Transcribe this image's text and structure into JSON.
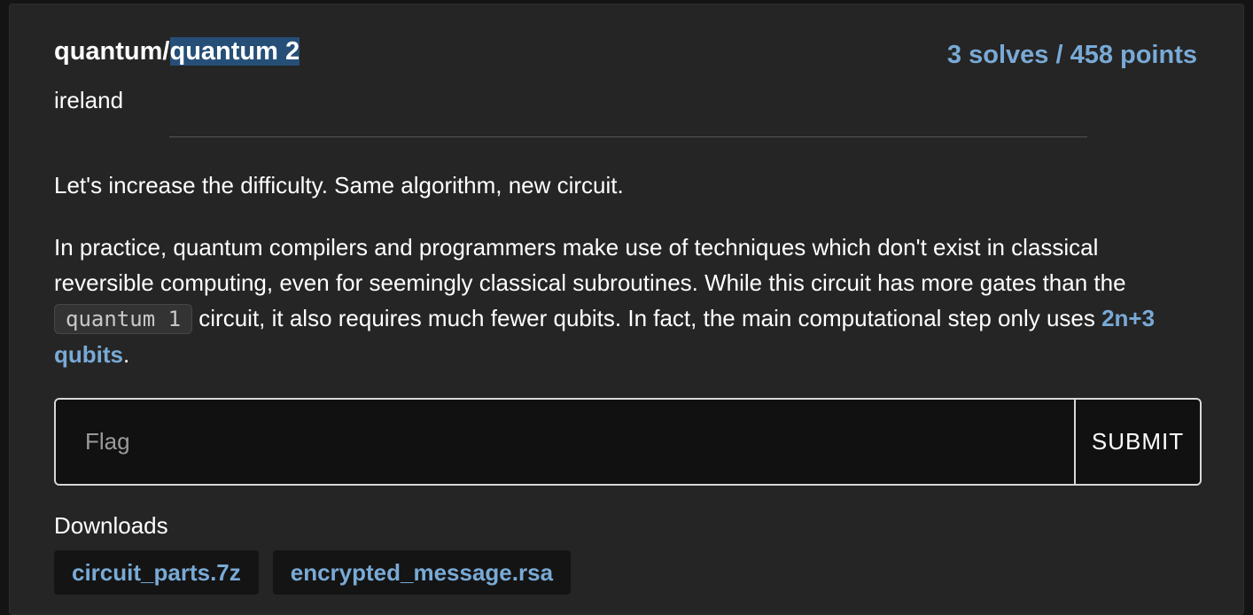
{
  "challenge": {
    "title_prefix": "quantum/",
    "title_selected": "quantum 2",
    "score": "3 solves / 458 points",
    "author": "ireland"
  },
  "description": {
    "p1": "Let's increase the difficulty. Same algorithm, new circuit.",
    "p2_part1": "In practice, quantum compilers and programmers make use of techniques which don't exist in classical reversible computing, even for seemingly classical subroutines. While this circuit has more gates than the ",
    "p2_code": "quantum 1",
    "p2_part2": " circuit, it also requires much fewer qubits. In fact, the main computational step only uses ",
    "p2_link": "2n+3 qubits",
    "p2_end": "."
  },
  "flag_form": {
    "placeholder": "Flag",
    "value": "",
    "submit_label": "SUBMIT"
  },
  "downloads": {
    "label": "Downloads",
    "files": [
      {
        "name": "circuit_parts.7z"
      },
      {
        "name": "encrypted_message.rsa"
      }
    ]
  },
  "colors": {
    "accent": "#79aad6",
    "selection": "#264f78",
    "card_bg": "#252525"
  }
}
